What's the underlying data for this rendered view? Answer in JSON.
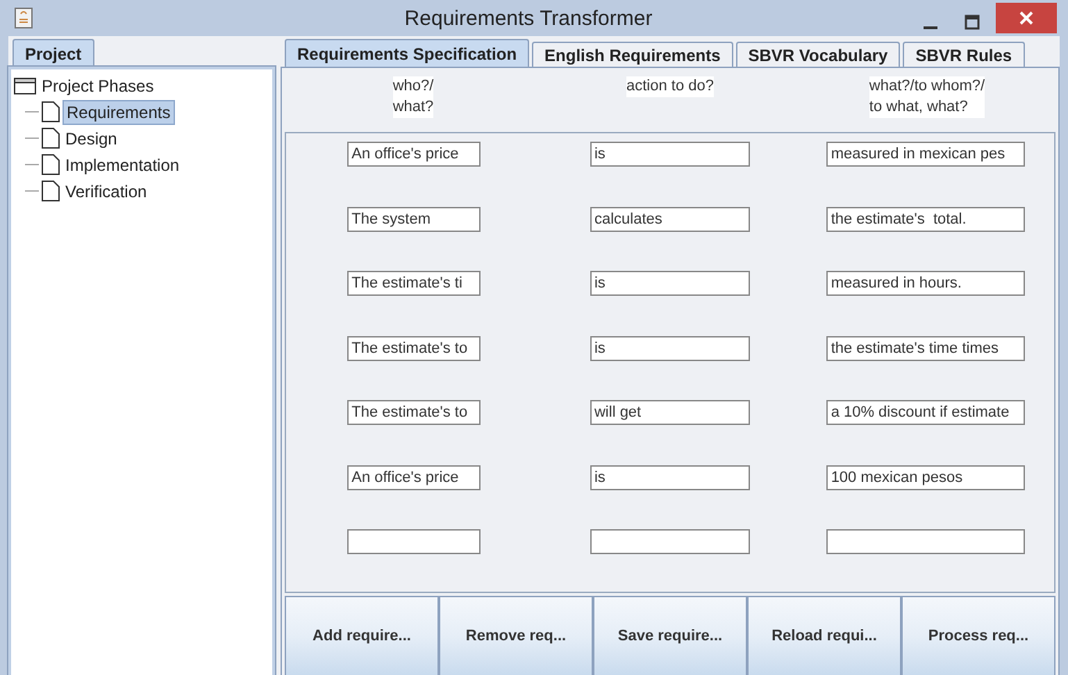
{
  "window": {
    "title": "Requirements Transformer"
  },
  "left_tabs": [
    {
      "label": "Project",
      "selected": true
    }
  ],
  "tree": {
    "label": "Project Phases",
    "expanded": true,
    "children": [
      {
        "label": "Requirements",
        "selected": true
      },
      {
        "label": "Design",
        "selected": false
      },
      {
        "label": "Implementation",
        "selected": false
      },
      {
        "label": "Verification",
        "selected": false
      }
    ]
  },
  "tabs": [
    {
      "label": "Requirements Specification",
      "selected": true
    },
    {
      "label": "English Requirements",
      "selected": false
    },
    {
      "label": "SBVR Vocabulary",
      "selected": false
    },
    {
      "label": "SBVR Rules",
      "selected": false
    }
  ],
  "columns": [
    [
      "who?/",
      "what?"
    ],
    [
      "action to do?"
    ],
    [
      "what?/to whom?/",
      "to what, what?"
    ]
  ],
  "rows": [
    [
      "An office's price",
      "is",
      "measured in mexican pes"
    ],
    [
      "The system",
      "calculates",
      "the estimate's  total."
    ],
    [
      "The estimate's ti",
      "is",
      "measured in hours."
    ],
    [
      "The estimate's to",
      "is",
      "the estimate's time times"
    ],
    [
      "The estimate's to",
      "will get",
      "a 10% discount if estimate"
    ],
    [
      "An office's price",
      "is",
      "100 mexican pesos"
    ],
    [
      "",
      "",
      ""
    ]
  ],
  "buttons": [
    "Add require...",
    "Remove req...",
    "Save require...",
    "Reload requi...",
    "Process req..."
  ]
}
